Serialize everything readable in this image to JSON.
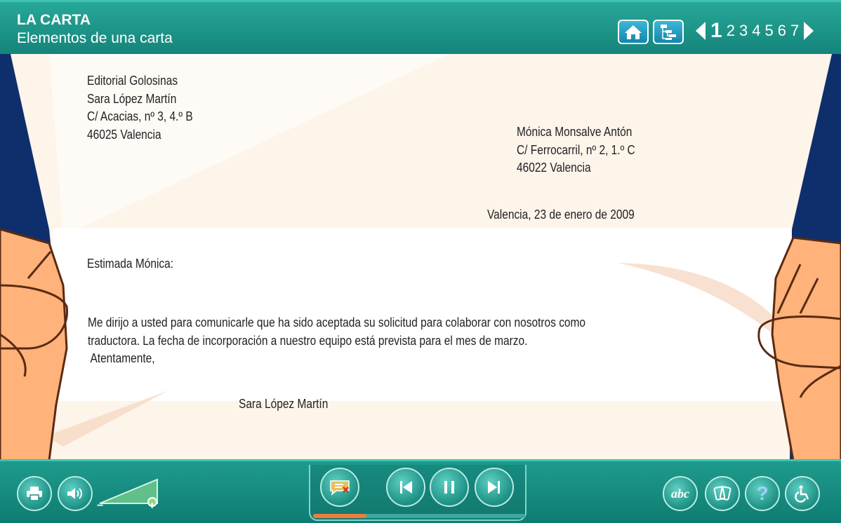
{
  "header": {
    "title": "LA CARTA",
    "subtitle": "Elementos de una carta",
    "home_icon": "home-icon",
    "index_icon": "index-tree-icon",
    "pages": [
      "1",
      "2",
      "3",
      "4",
      "5",
      "6",
      "7"
    ],
    "current_page": 1
  },
  "letter": {
    "sender": [
      "Editorial Golosinas",
      "Sara López Martín",
      "C/ Acacias, nº 3, 4.º B",
      "46025 Valencia"
    ],
    "recipient": [
      "Mónica Monsalve Antón",
      "C/ Ferrocarril, nº 2, 1.º C",
      "46022 Valencia"
    ],
    "date": "Valencia, 23 de enero de 2009",
    "greeting": "Estimada Mónica:",
    "body": [
      "Me dirijo a usted para comunicarle que ha sido aceptada su solicitud para colaborar con nosotros como",
      "traductora. La fecha de incorporación a nuestro equipo está prevista para el mes de marzo."
    ],
    "closing": " Atentamente,",
    "signature": "Sara López Martín"
  },
  "footer": {
    "volume_minus": "−",
    "volume_plus": "+",
    "abc_label": "abc",
    "help_label": "?",
    "progress_fraction": 0.25
  },
  "colors": {
    "header_teal": "#1b9a8c",
    "navy_background": "#0e2f6b",
    "paper": "#fdf3e8",
    "skin": "#ffb27a",
    "progress_orange": "#f07b3c"
  }
}
